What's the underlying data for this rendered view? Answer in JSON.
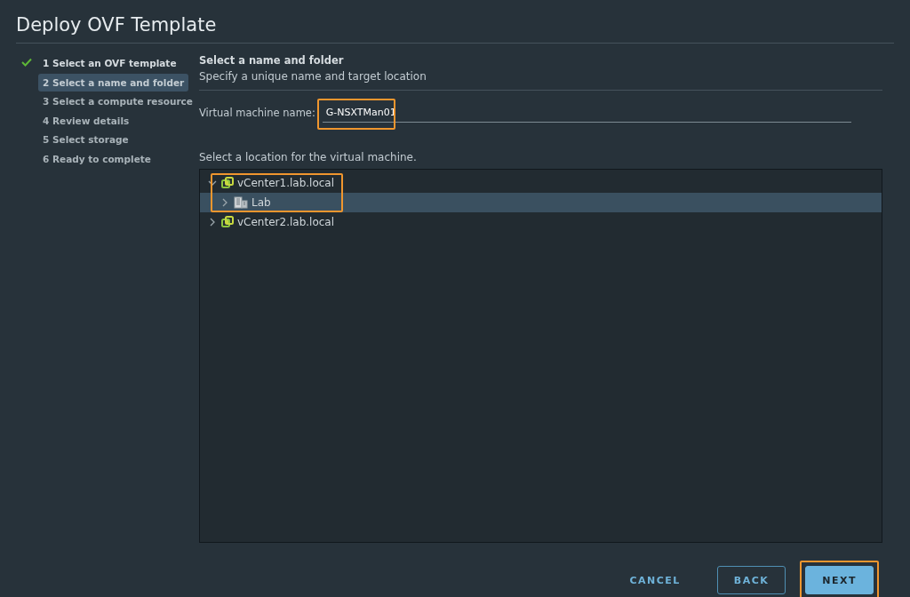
{
  "window": {
    "title": "Deploy OVF Template"
  },
  "steps": [
    {
      "label": "1 Select an OVF template",
      "completed": true,
      "selected": false
    },
    {
      "label": "2 Select a name and folder",
      "completed": false,
      "selected": true
    },
    {
      "label": "3 Select a compute resource",
      "completed": false,
      "selected": false
    },
    {
      "label": "4 Review details",
      "completed": false,
      "selected": false
    },
    {
      "label": "5 Select storage",
      "completed": false,
      "selected": false
    },
    {
      "label": "6 Ready to complete",
      "completed": false,
      "selected": false
    }
  ],
  "page": {
    "heading": "Select a name and folder",
    "subheading": "Specify a unique name and target location"
  },
  "name_field": {
    "label": "Virtual machine name:",
    "value": "G-NSXTMan01",
    "highlighted": true
  },
  "location": {
    "label": "Select a location for the virtual machine.",
    "tree": [
      {
        "label": "vCenter1.lab.local",
        "kind": "vcenter",
        "expanded": true,
        "selected": false,
        "highlighted": true,
        "children": [
          {
            "label": "Lab",
            "kind": "datacenter",
            "expanded": false,
            "selected": true,
            "highlighted": false
          }
        ]
      },
      {
        "label": "vCenter2.lab.local",
        "kind": "vcenter",
        "expanded": false,
        "selected": false,
        "highlighted": false
      }
    ]
  },
  "buttons": [
    {
      "label": "CANCEL",
      "kind": "link",
      "highlighted": false
    },
    {
      "label": "BACK",
      "kind": "outline",
      "highlighted": false
    },
    {
      "label": "NEXT",
      "kind": "primary",
      "highlighted": true
    }
  ]
}
